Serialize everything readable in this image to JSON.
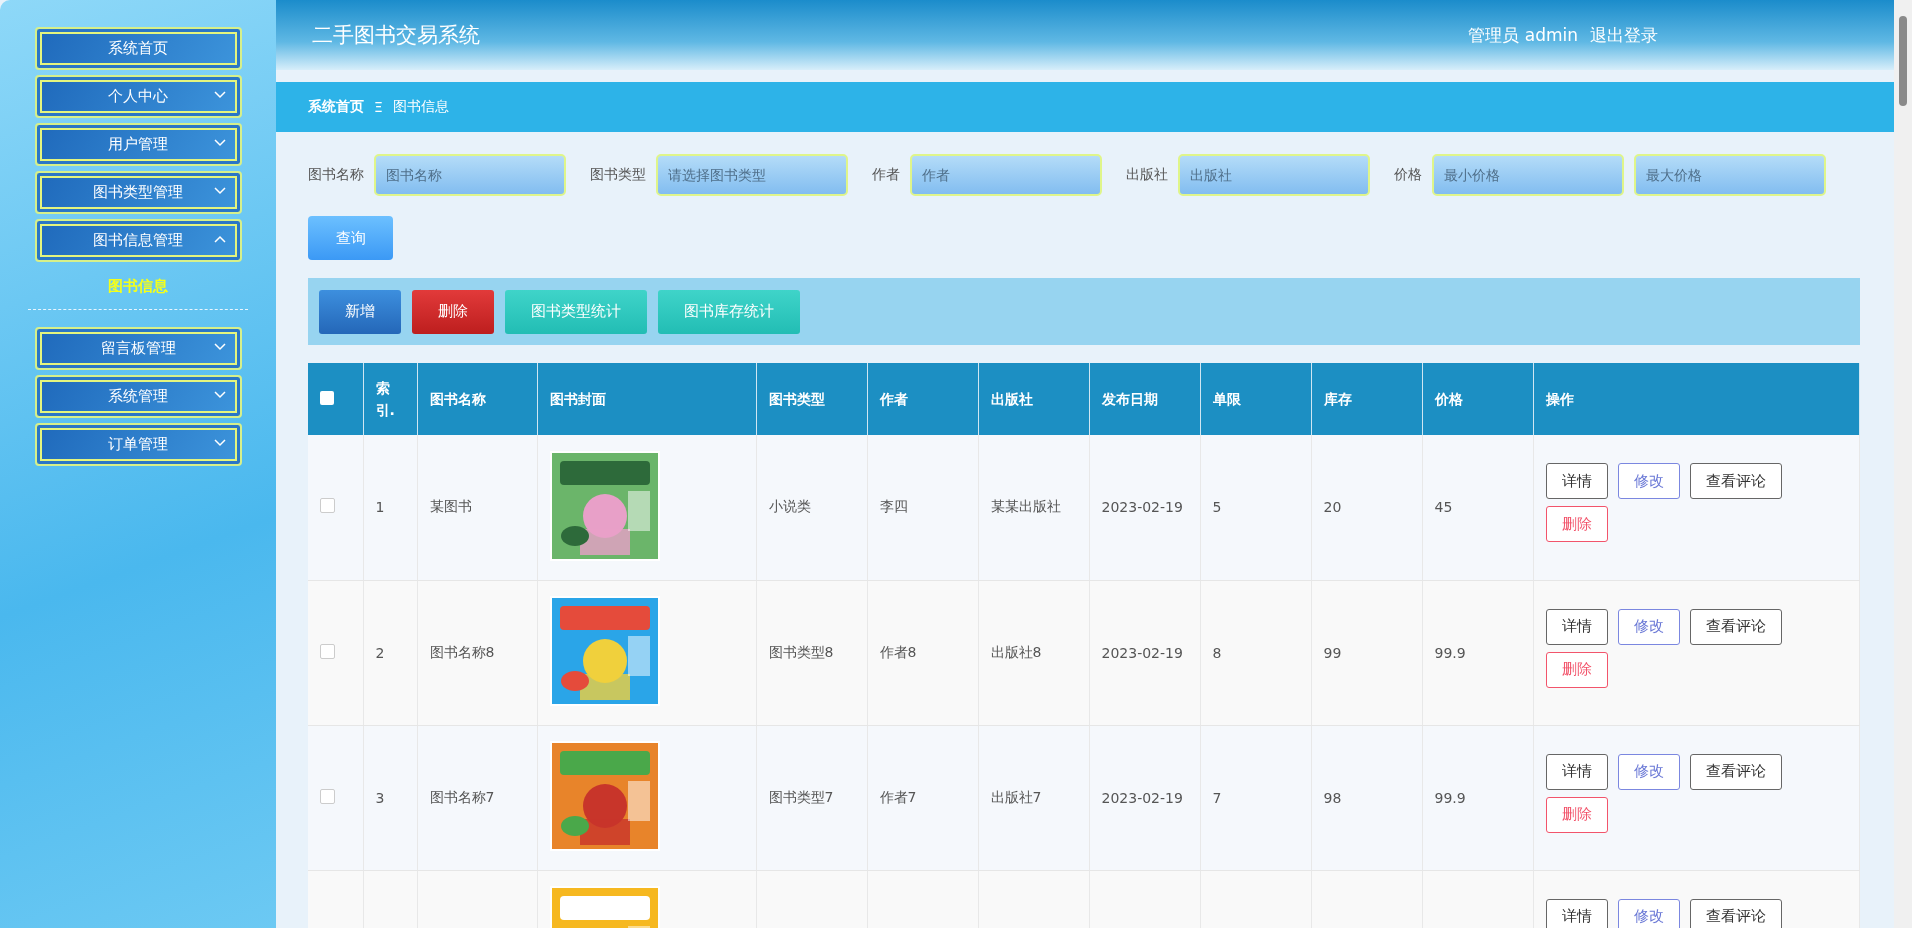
{
  "sidebar": {
    "items": [
      {
        "label": "系统首页",
        "has_caret": false
      },
      {
        "label": "个人中心",
        "expanded": false,
        "has_caret": true
      },
      {
        "label": "用户管理",
        "expanded": false,
        "has_caret": true
      },
      {
        "label": "图书类型管理",
        "expanded": false,
        "has_caret": true
      },
      {
        "label": "图书信息管理",
        "expanded": true,
        "has_caret": true,
        "children": [
          {
            "label": "图书信息",
            "selected": true
          }
        ]
      },
      {
        "label": "留言板管理",
        "expanded": false,
        "has_caret": true
      },
      {
        "label": "系统管理",
        "expanded": false,
        "has_caret": true
      },
      {
        "label": "订单管理",
        "expanded": false,
        "has_caret": true
      }
    ]
  },
  "header": {
    "title": "二手图书交易系统",
    "user": "管理员 admin",
    "logout": "退出登录"
  },
  "breadcrumb": {
    "home": "系统首页",
    "separator": "Ξ",
    "current": "图书信息"
  },
  "search": {
    "fields": [
      {
        "label": "图书名称",
        "placeholder": "图书名称"
      },
      {
        "label": "图书类型",
        "placeholder": "请选择图书类型"
      },
      {
        "label": "作者",
        "placeholder": "作者"
      },
      {
        "label": "出版社",
        "placeholder": "出版社"
      },
      {
        "label": "价格",
        "placeholder": "最小价格"
      },
      {
        "placeholder": "最大价格"
      }
    ],
    "button": "查询"
  },
  "actions": [
    {
      "label": "新增",
      "kind": "primary"
    },
    {
      "label": "删除",
      "kind": "danger"
    },
    {
      "label": "图书类型统计",
      "kind": "teal"
    },
    {
      "label": "图书库存统计",
      "kind": "teal"
    }
  ],
  "table": {
    "select_all_checked": false,
    "columns": [
      "索引.",
      "图书名称",
      "图书封面",
      "图书类型",
      "作者",
      "出版社",
      "发布日期",
      "单限",
      "库存",
      "价格",
      "操作"
    ],
    "rows": [
      {
        "checked": false,
        "cells": [
          "1",
          "某图书",
          "",
          "小说类",
          "李四",
          "某某出版社",
          "2023-02-19",
          "5",
          "20",
          "45"
        ],
        "buttons": [
          {
            "label": "详情",
            "kind": "plain"
          },
          {
            "label": "修改",
            "kind": "edit"
          },
          {
            "label": "查看评论",
            "kind": "plain"
          },
          {
            "label": "删除",
            "kind": "delete"
          }
        ]
      },
      {
        "checked": false,
        "cells": [
          "2",
          "图书名称8",
          "",
          "图书类型8",
          "作者8",
          "出版社8",
          "2023-02-19",
          "8",
          "99",
          "99.9"
        ],
        "buttons": [
          {
            "label": "详情",
            "kind": "plain"
          },
          {
            "label": "修改",
            "kind": "edit"
          },
          {
            "label": "查看评论",
            "kind": "plain"
          },
          {
            "label": "删除",
            "kind": "delete"
          }
        ]
      },
      {
        "checked": false,
        "cells": [
          "3",
          "图书名称7",
          "",
          "图书类型7",
          "作者7",
          "出版社7",
          "2023-02-19",
          "7",
          "98",
          "99.9"
        ],
        "buttons": [
          {
            "label": "详情",
            "kind": "plain"
          },
          {
            "label": "修改",
            "kind": "edit"
          },
          {
            "label": "查看评论",
            "kind": "plain"
          },
          {
            "label": "删除",
            "kind": "delete"
          }
        ]
      },
      {
        "buttons": [
          {
            "label": "详情",
            "kind": "plain"
          },
          {
            "label": "修改",
            "kind": "edit"
          },
          {
            "label": "查看评论",
            "kind": "plain"
          }
        ]
      }
    ]
  }
}
